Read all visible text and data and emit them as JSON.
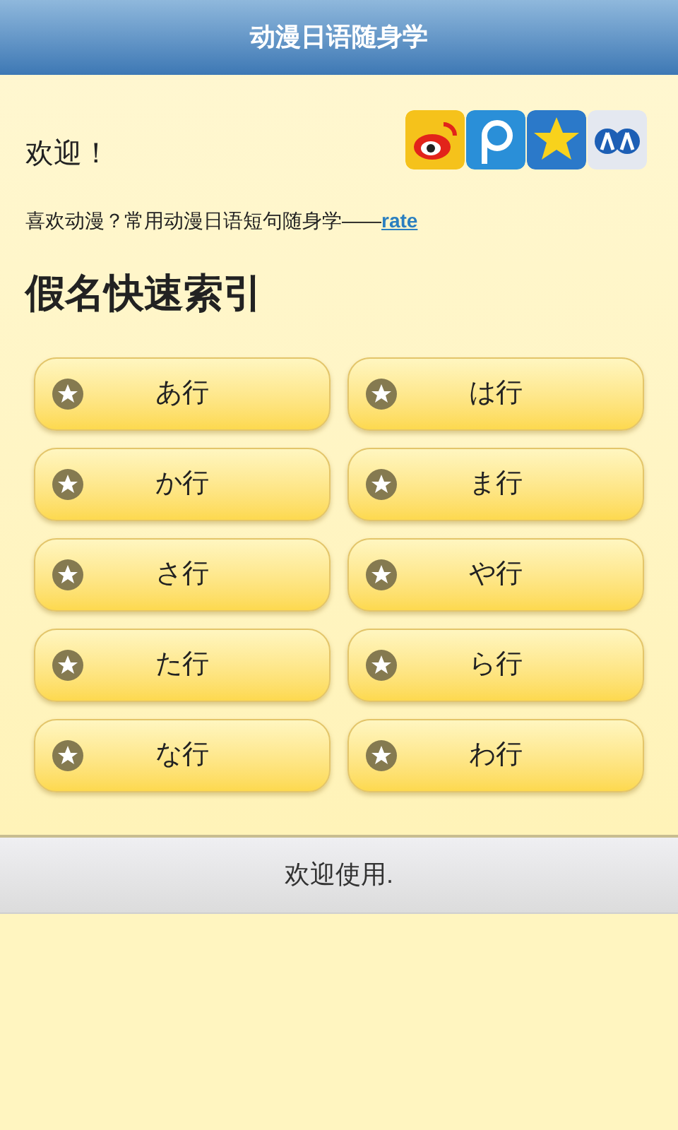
{
  "title_bar": {
    "title": "动漫日语随身学"
  },
  "welcome": "欢迎！",
  "share_icons": [
    {
      "kind": "weibo"
    },
    {
      "kind": "p"
    },
    {
      "kind": "star"
    },
    {
      "kind": "people"
    }
  ],
  "intro": {
    "text": "喜欢动漫？常用动漫日语短句随身学——",
    "link": "rate"
  },
  "heading": "假名快速索引",
  "kana_buttons": [
    {
      "label": "あ行"
    },
    {
      "label": "は行"
    },
    {
      "label": "か行"
    },
    {
      "label": "ま行"
    },
    {
      "label": "さ行"
    },
    {
      "label": "や行"
    },
    {
      "label": "た行"
    },
    {
      "label": "ら行"
    },
    {
      "label": "な行"
    },
    {
      "label": "わ行"
    }
  ],
  "footer": "欢迎使用."
}
